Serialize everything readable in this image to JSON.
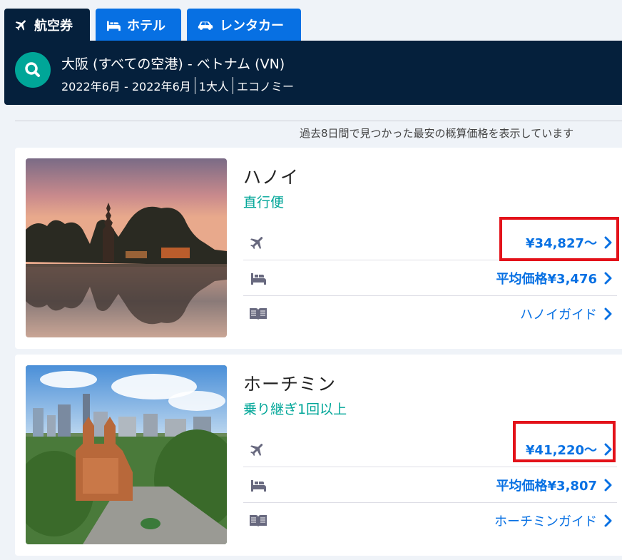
{
  "tabs": [
    {
      "label": "航空券",
      "icon": "airplane-icon",
      "active": true
    },
    {
      "label": "ホテル",
      "icon": "bed-icon",
      "active": false
    },
    {
      "label": "レンタカー",
      "icon": "car-icon",
      "active": false
    }
  ],
  "search": {
    "route": "大阪 (すべての空港) - ベトナム (VN)",
    "dates": "2022年6月 - 2022年6月",
    "travelers": "1大人",
    "cabin": "エコノミー"
  },
  "notice": "過去8日間で見つかった最安の概算価格を表示しています",
  "colors": {
    "navy": "#05203c",
    "blue": "#0770e3",
    "teal": "#00a698",
    "highlight": "#e3121a"
  },
  "destinations": [
    {
      "city": "ハノイ",
      "flight_type": "直行便",
      "flight_price": "¥34,827〜",
      "hotel_price": "平均価格¥3,476",
      "guide": "ハノイガイド"
    },
    {
      "city": "ホーチミン",
      "flight_type": "乗り継ぎ1回以上",
      "flight_price": "¥41,220〜",
      "hotel_price": "平均価格¥3,807",
      "guide": "ホーチミンガイド"
    }
  ]
}
